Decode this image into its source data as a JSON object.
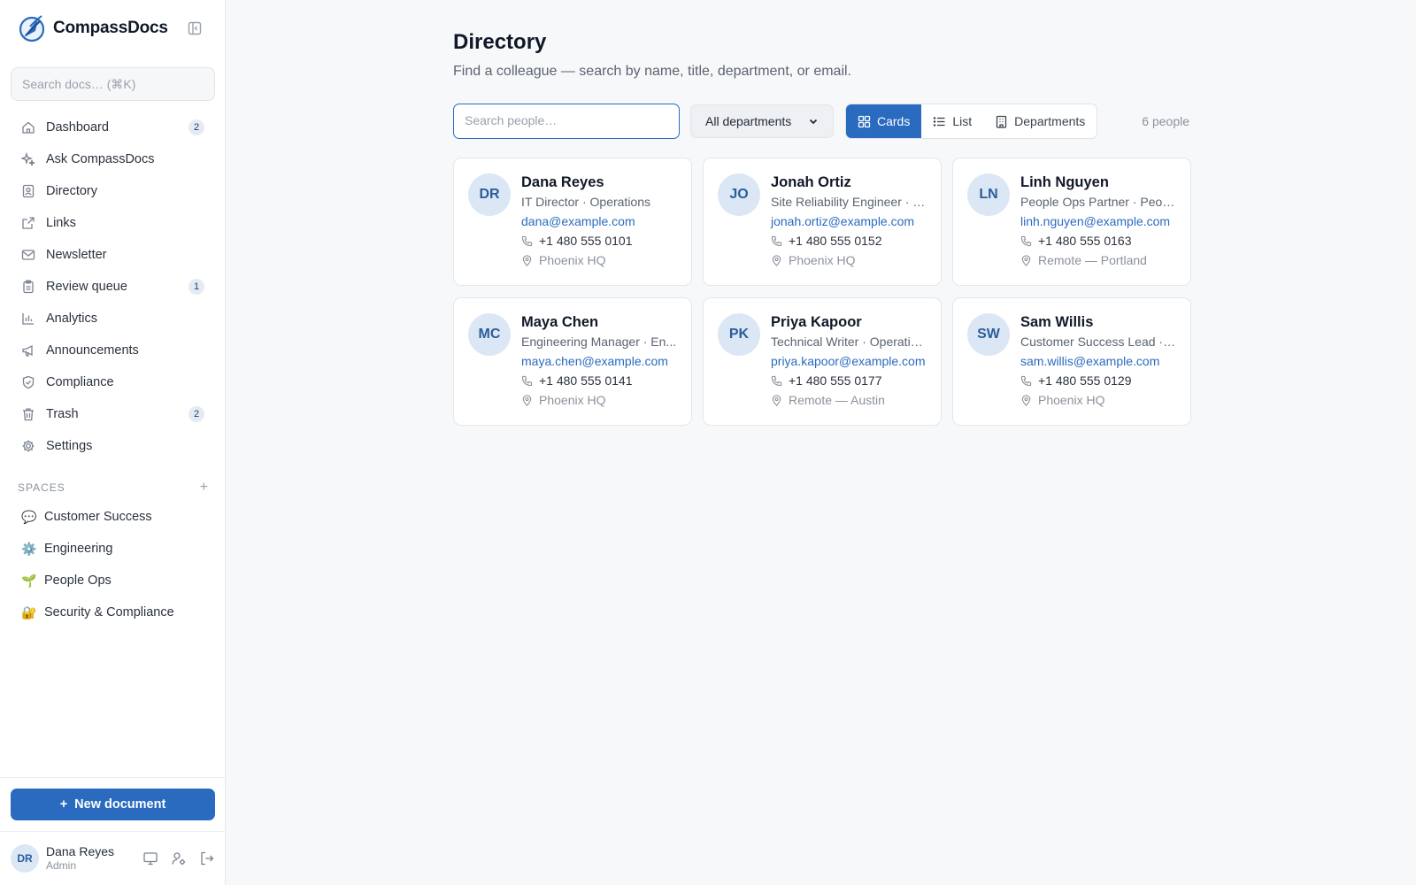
{
  "app": {
    "name": "CompassDocs",
    "search_placeholder": "Search docs… (⌘K)"
  },
  "nav": [
    {
      "label": "Dashboard",
      "icon": "home-icon",
      "badge": "2"
    },
    {
      "label": "Ask CompassDocs",
      "icon": "sparkle-icon",
      "badge": ""
    },
    {
      "label": "Directory",
      "icon": "contact-book-icon",
      "badge": ""
    },
    {
      "label": "Links",
      "icon": "external-link-icon",
      "badge": ""
    },
    {
      "label": "Newsletter",
      "icon": "mail-icon",
      "badge": ""
    },
    {
      "label": "Review queue",
      "icon": "clipboard-icon",
      "badge": "1"
    },
    {
      "label": "Analytics",
      "icon": "bar-chart-icon",
      "badge": ""
    },
    {
      "label": "Announcements",
      "icon": "megaphone-icon",
      "badge": ""
    },
    {
      "label": "Compliance",
      "icon": "shield-check-icon",
      "badge": ""
    },
    {
      "label": "Trash",
      "icon": "trash-icon",
      "badge": "2"
    },
    {
      "label": "Settings",
      "icon": "gear-icon",
      "badge": ""
    }
  ],
  "spaces": {
    "heading": "SPACES",
    "add": "+",
    "items": [
      {
        "emoji": "💬",
        "label": "Customer Success"
      },
      {
        "emoji": "⚙️",
        "label": "Engineering"
      },
      {
        "emoji": "🌱",
        "label": "People Ops"
      },
      {
        "emoji": "🔐",
        "label": "Security & Compliance"
      }
    ]
  },
  "new_document": {
    "plus": "+",
    "label": "New document"
  },
  "user": {
    "initials": "DR",
    "name": "Dana Reyes",
    "role": "Admin"
  },
  "page": {
    "title": "Directory",
    "subtitle": "Find a colleague — search by name, title, department, or email.",
    "search_placeholder": "Search people…",
    "department_filter": "All departments",
    "views": {
      "cards": "Cards",
      "list": "List",
      "departments": "Departments",
      "active": "Cards"
    },
    "count": "6 people"
  },
  "people": [
    {
      "initials": "DR",
      "name": "Dana Reyes",
      "title": "IT Director · Operations",
      "email": "dana@example.com",
      "phone": "+1 480 555 0101",
      "location": "Phoenix HQ"
    },
    {
      "initials": "JO",
      "name": "Jonah Ortiz",
      "title": "Site Reliability Engineer · E...",
      "email": "jonah.ortiz@example.com",
      "phone": "+1 480 555 0152",
      "location": "Phoenix HQ"
    },
    {
      "initials": "LN",
      "name": "Linh Nguyen",
      "title": "People Ops Partner · Peopl...",
      "email": "linh.nguyen@example.com",
      "phone": "+1 480 555 0163",
      "location": "Remote — Portland"
    },
    {
      "initials": "MC",
      "name": "Maya Chen",
      "title": "Engineering Manager · En...",
      "email": "maya.chen@example.com",
      "phone": "+1 480 555 0141",
      "location": "Phoenix HQ"
    },
    {
      "initials": "PK",
      "name": "Priya Kapoor",
      "title": "Technical Writer · Operatio...",
      "email": "priya.kapoor@example.com",
      "phone": "+1 480 555 0177",
      "location": "Remote — Austin"
    },
    {
      "initials": "SW",
      "name": "Sam Willis",
      "title": "Customer Success Lead · ...",
      "email": "sam.willis@example.com",
      "phone": "+1 480 555 0129",
      "location": "Phoenix HQ"
    }
  ],
  "colors": {
    "accent": "#2a6bbf",
    "avatar_bg": "#dbe7f5",
    "avatar_text": "#2a5d9b"
  }
}
